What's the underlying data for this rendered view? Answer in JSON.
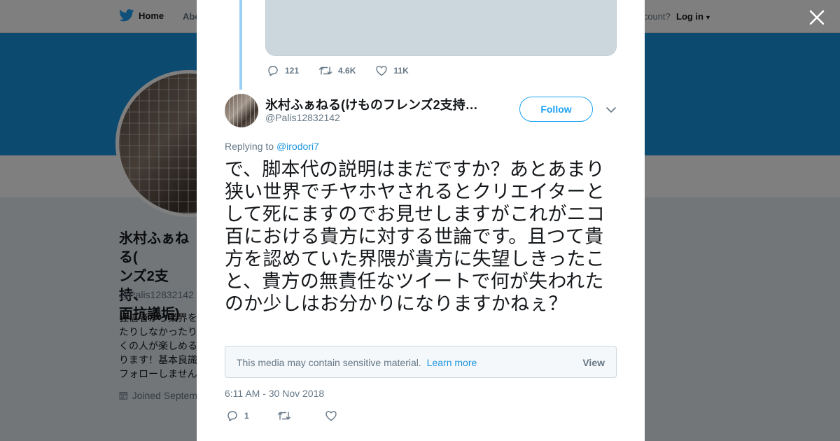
{
  "nav": {
    "home_label": "Home",
    "about_label": "Abo",
    "account_prompt": "account?",
    "login_label": "Log in"
  },
  "profile": {
    "name": "氷村ふぁねる(\nンズ2支持、\n面抗議垢)",
    "handle": "@Palis12832142",
    "bio": "狂信者から業界を\nたりしなかったり\nくの人が楽しめる\nります！基本良識\nフォローしません",
    "joined": "Joined Septem"
  },
  "previous_tweet": {
    "replies": "121",
    "retweets": "4.6K",
    "likes": "11K"
  },
  "tweet": {
    "author_name": "氷村ふぁねる(けものフレンズ2支持…",
    "author_handle": "@Palis12832142",
    "follow_label": "Follow",
    "replying_prefix": "Replying to",
    "replying_to": "@irodori7",
    "text": "で、脚本代の説明はまだですか？あとあまり狭い世界でチヤホヤされるとクリエイターとして死にますのでお見せしますがこれがニコ百における貴方に対する世論です。且つて貴方を認めていた界隈が貴方に失望しきったこと、貴方の無責任なツイートで何が失われたのか少しはお分かりになりますかねぇ？",
    "sensitive_notice": "This media may contain sensitive material.",
    "learn_more": "Learn more",
    "view_label": "View",
    "timestamp": "6:11 AM - 30 Nov 2018",
    "replies": "1",
    "retweets": "",
    "likes": ""
  },
  "colors": {
    "accent": "#1da1f2",
    "banner": "#1b95e0",
    "thread_line": "#9ad0f5",
    "muted": "#657786"
  }
}
